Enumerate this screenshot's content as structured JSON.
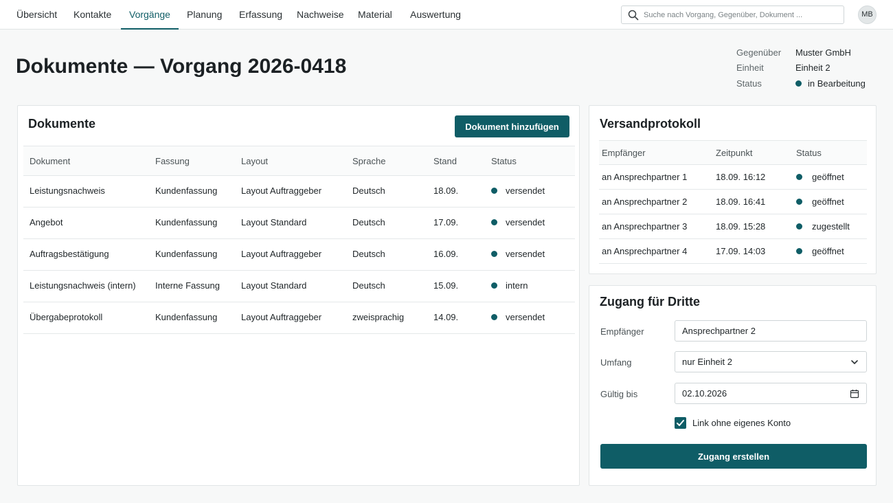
{
  "nav": {
    "tabs": [
      {
        "label": "Übersicht"
      },
      {
        "label": "Kontakte"
      },
      {
        "label": "Vorgänge",
        "active": true
      },
      {
        "label": "Planung"
      },
      {
        "label": "Erfassung"
      },
      {
        "label": "Nachweise"
      },
      {
        "label": "Material"
      },
      {
        "label": "Auswertung"
      }
    ],
    "search_placeholder": "Suche nach Vorgang, Gegenüber, Dokument ...",
    "avatar_initials": "MB"
  },
  "header": {
    "title": "Dokumente — Vorgang 2026-0418",
    "meta": [
      {
        "label": "Gegenüber",
        "value": "Muster GmbH"
      },
      {
        "label": "Einheit",
        "value": "Einheit 2"
      },
      {
        "label": "Status",
        "value": "in Bearbeitung"
      }
    ]
  },
  "documents": {
    "title": "Dokumente",
    "add_button": "Dokument hinzufügen",
    "columns": [
      "Dokument",
      "Fassung",
      "Layout",
      "Sprache",
      "Stand",
      "Status"
    ],
    "rows": [
      [
        "Leistungsnachweis",
        "Kundenfassung",
        "Layout Auftraggeber",
        "Deutsch",
        "18.09.",
        "versendet"
      ],
      [
        "Angebot",
        "Kundenfassung",
        "Layout Standard",
        "Deutsch",
        "17.09.",
        "versendet"
      ],
      [
        "Auftragsbestätigung",
        "Kundenfassung",
        "Layout Auftraggeber",
        "Deutsch",
        "16.09.",
        "versendet"
      ],
      [
        "Leistungsnachweis (intern)",
        "Interne Fassung",
        "Layout Standard",
        "Deutsch",
        "15.09.",
        "intern"
      ],
      [
        "Übergabeprotokoll",
        "Kundenfassung",
        "Layout Auftraggeber",
        "zweisprachig",
        "14.09.",
        "versendet"
      ]
    ]
  },
  "versand": {
    "title": "Versandprotokoll",
    "columns": [
      "Empfänger",
      "Zeitpunkt",
      "Status"
    ],
    "rows": [
      [
        "an Ansprechpartner 1",
        "18.09. 16:12",
        "geöffnet"
      ],
      [
        "an Ansprechpartner 2",
        "18.09. 16:41",
        "geöffnet"
      ],
      [
        "an Ansprechpartner 3",
        "18.09. 15:28",
        "zugestellt"
      ],
      [
        "an Ansprechpartner 4",
        "17.09. 14:03",
        "geöffnet"
      ]
    ]
  },
  "zugang": {
    "title": "Zugang für Dritte",
    "empfaenger_label": "Empfänger",
    "empfaenger_value": "Ansprechpartner 2",
    "umfang_label": "Umfang",
    "umfang_value": "nur Einheit 2",
    "gueltig_label": "Gültig bis",
    "gueltig_value": "02.10.2026",
    "checkbox_label": "Link ohne eigenes Konto",
    "checkbox_checked": true,
    "submit_label": "Zugang erstellen"
  },
  "colors": {
    "accent": "#0f5d66",
    "status_dot": "#0f5d66"
  }
}
